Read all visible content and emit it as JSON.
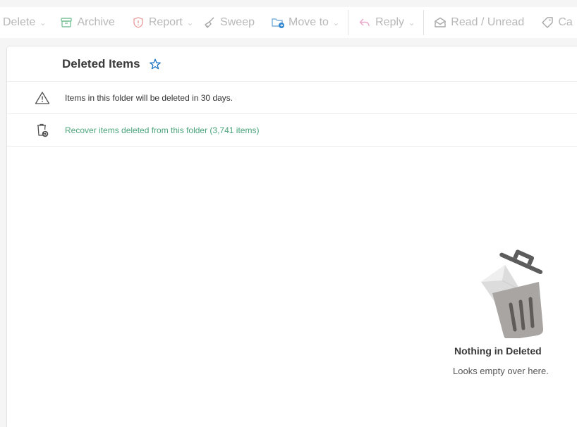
{
  "toolbar": {
    "delete_label": "Delete",
    "archive_label": "Archive",
    "report_label": "Report",
    "sweep_label": "Sweep",
    "move_to_label": "Move to",
    "reply_label": "Reply",
    "read_unread_label": "Read / Unread",
    "categorize_label": "Ca"
  },
  "folder": {
    "title": "Deleted Items"
  },
  "notices": {
    "retention_text": "Items in this folder will be deleted in 30 days.",
    "recover_link": "Recover items deleted from this folder (3,741 items)"
  },
  "empty_state": {
    "title": "Nothing in Deleted",
    "subtitle": "Looks empty over here."
  },
  "colors": {
    "accent_blue": "#0f6cbd",
    "link_green": "#4aa37a",
    "disabled_text": "#b8b8b8",
    "reply_pink": "#e8a6c8",
    "report_red": "#e8a0a0",
    "archive_green": "#7cc49a"
  },
  "icons": {
    "delete": "chevron-down-icon",
    "archive": "archive-icon",
    "report": "shield-icon",
    "sweep": "broom-icon",
    "move_to": "folder-move-icon",
    "reply": "reply-icon",
    "read_unread": "envelope-open-icon",
    "categorize": "tag-icon",
    "favorite": "star-icon",
    "warning": "warning-icon",
    "recover": "recycle-bin-icon"
  }
}
